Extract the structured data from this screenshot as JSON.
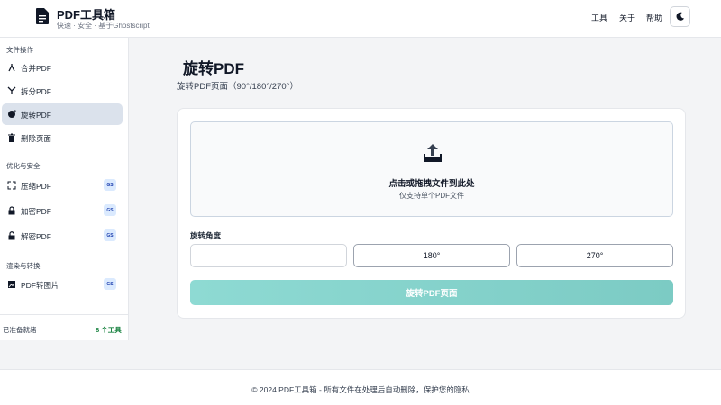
{
  "header": {
    "title": "PDF工具箱",
    "subtitle": "快速 · 安全 · 基于Ghostscript",
    "nav": [
      "工具",
      "关于",
      "帮助"
    ]
  },
  "sidebar": {
    "sections": [
      {
        "title": "文件操作",
        "items": [
          {
            "label": "合并PDF",
            "icon": "merge-icon"
          },
          {
            "label": "拆分PDF",
            "icon": "split-icon"
          },
          {
            "label": "旋转PDF",
            "icon": "rotate-icon",
            "active": true
          },
          {
            "label": "删除页面",
            "icon": "trash-icon"
          }
        ]
      },
      {
        "title": "优化与安全",
        "items": [
          {
            "label": "压缩PDF",
            "icon": "compress-icon",
            "badge": "GS"
          },
          {
            "label": "加密PDF",
            "icon": "lock-icon",
            "badge": "GS"
          },
          {
            "label": "解密PDF",
            "icon": "unlock-icon",
            "badge": "GS"
          }
        ]
      },
      {
        "title": "渲染与转换",
        "items": [
          {
            "label": "PDF转图片",
            "icon": "image-icon",
            "badge": "GS"
          }
        ]
      }
    ],
    "status": "已准备就绪",
    "tool_count": "8 个工具"
  },
  "main": {
    "title": "旋转PDF",
    "subtitle": "旋转PDF页面（90°/180°/270°）",
    "dropzone": {
      "title": "点击或拖拽文件到此处",
      "subtitle": "仅支持单个PDF文件"
    },
    "angle_label": "旋转角度",
    "angle_options": [
      "",
      "180°",
      "270°"
    ],
    "submit_label": "旋转PDF页面"
  },
  "footer": {
    "text": "© 2024 PDF工具箱 - 所有文件在处理后自动删除，保护您的隐私"
  }
}
